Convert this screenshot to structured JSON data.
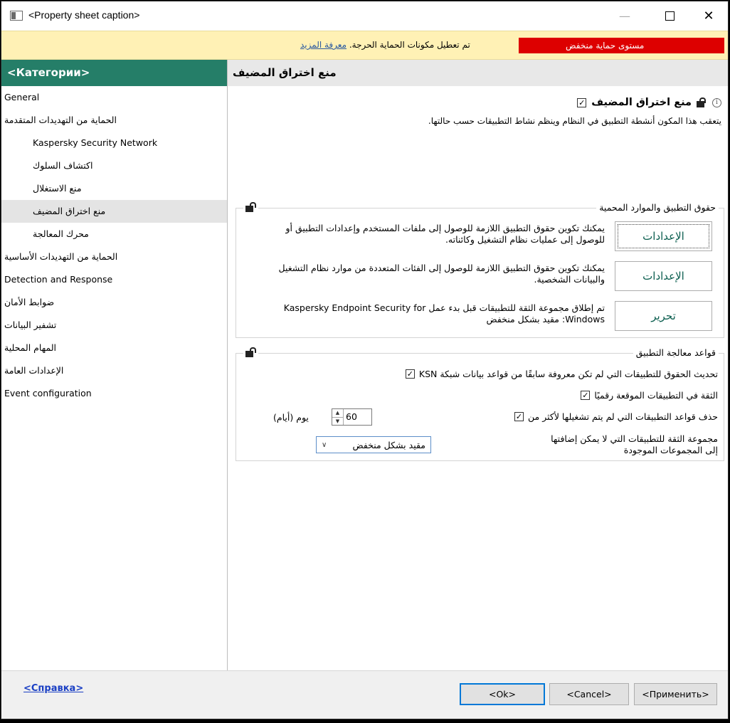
{
  "window": {
    "title": "<Property sheet caption>",
    "minimize_glyph": "—",
    "close_glyph": "✕"
  },
  "banner": {
    "level_text": "مستوى حماية منخفض",
    "message": "تم تعطيل مكونات الحماية الحرجة.",
    "learn_more": "معرفة المزيد",
    "level_color": "#dd0000",
    "background": "#fff1b5"
  },
  "sidebar": {
    "header": "<Категории>",
    "header_color": "#257e68",
    "items": [
      {
        "label": "General",
        "level": 0
      },
      {
        "label": "الحماية من التهديدات المتقدمة",
        "level": 0
      },
      {
        "label": "Kaspersky Security Network",
        "level": 1
      },
      {
        "label": "اكتشاف السلوك",
        "level": 1
      },
      {
        "label": "منع الاستغلال",
        "level": 1
      },
      {
        "label": "منع اختراق المضيف",
        "level": 1,
        "selected": true
      },
      {
        "label": "محرك المعالجة",
        "level": 1
      },
      {
        "label": "الحماية من التهديدات الأساسية",
        "level": 0
      },
      {
        "label": "Detection and Response",
        "level": 0
      },
      {
        "label": "ضوابط الأمان",
        "level": 0
      },
      {
        "label": "تشفير البيانات",
        "level": 0
      },
      {
        "label": "المهام المحلية",
        "level": 0
      },
      {
        "label": "الإعدادات العامة",
        "level": 0
      },
      {
        "label": "Event configuration",
        "level": 0
      }
    ]
  },
  "main": {
    "page_title": "منع اختراق المضيف",
    "component": {
      "label": "منع اختراق المضيف",
      "checked": true,
      "check_glyph": "✓",
      "info_glyph": "i",
      "description": "يتعقب هذا المكون أنشطة التطبيق في النظام وينظم نشاط التطبيقات حسب حالتها."
    },
    "rights_group": {
      "title": "حقوق التطبيق والموارد المحمية",
      "rows": [
        {
          "description": "يمكنك تكوين حقوق التطبيق اللازمة للوصول إلى ملفات المستخدم وإعدادات التطبيق أو للوصول إلى عمليات نظام التشغيل وكائناته.",
          "button": "الإعدادات"
        },
        {
          "description": "يمكنك تكوين حقوق التطبيق اللازمة للوصول إلى الفئات المتعددة من موارد نظام التشغيل والبيانات الشخصية.",
          "button": "الإعدادات"
        },
        {
          "description": "تم إطلاق مجموعة الثقة للتطبيقات قبل بدء عمل Kaspersky Endpoint Security for Windows: مقيد بشكل منخفض",
          "button": "تحرير"
        }
      ]
    },
    "rules_group": {
      "title": "قواعد معالجة التطبيق",
      "update_rights": {
        "label": "تحديث الحقوق للتطبيقات التي لم تكن معروفة سابقًا من قواعد بيانات شبكة KSN",
        "checked": true
      },
      "trust_signed": {
        "label": "الثقة في التطبيقات الموقعة رقميًا",
        "checked": true
      },
      "delete_rules": {
        "label": "حذف قواعد التطبيقات التي لم يتم تشغيلها لأكثر من",
        "checked": true
      },
      "days_value": "60",
      "days_unit": "يوم (أيام)",
      "spin_up": "▲",
      "spin_down": "▼",
      "trust_group_label": "مجموعة الثقة للتطبيقات التي لا يمكن إضافتها إلى المجموعات الموجودة",
      "trust_group_value": "مقيد بشكل منخفض",
      "chevron_glyph": "∨"
    }
  },
  "footer": {
    "help": "<Справка>",
    "ok": "<Ok>",
    "cancel": "<Cancel>",
    "apply": "<Применить>"
  }
}
